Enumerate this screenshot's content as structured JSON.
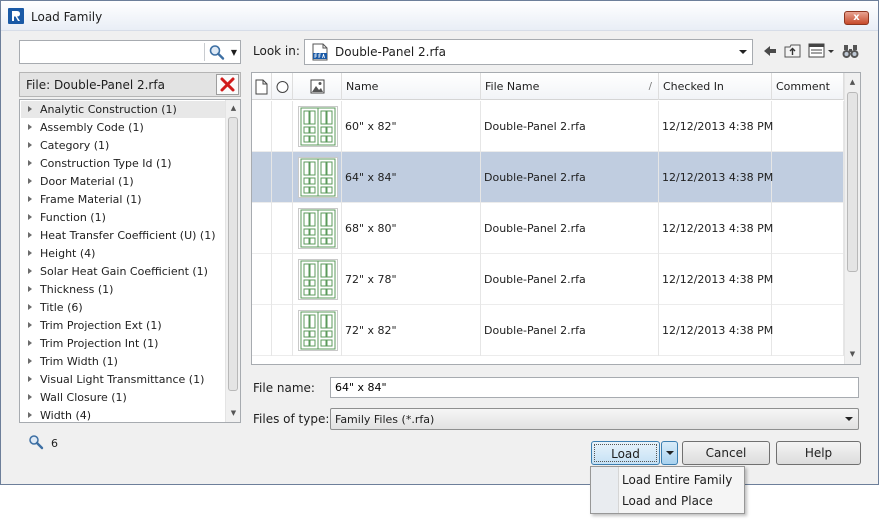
{
  "window": {
    "title": "Load Family",
    "close_label": "x"
  },
  "search": {
    "placeholder": "",
    "value": "",
    "match_count": "6"
  },
  "filter_file": {
    "label": "File: Double-Panel 2.rfa"
  },
  "parameters": [
    "Analytic Construction (1)",
    "Assembly Code (1)",
    "Category (1)",
    "Construction Type Id (1)",
    "Door Material (1)",
    "Frame Material (1)",
    "Function (1)",
    "Heat Transfer Coefficient (U) (1)",
    "Height (4)",
    "Solar Heat Gain Coefficient (1)",
    "Thickness (1)",
    "Title (6)",
    "Trim Projection Ext (1)",
    "Trim Projection Int (1)",
    "Trim Width (1)",
    "Visual Light Transmittance (1)",
    "Wall Closure (1)",
    "Width (4)"
  ],
  "look_in": {
    "label": "Look in:",
    "value": "Double-Panel 2.rfa"
  },
  "grid": {
    "columns": [
      "Name",
      "File Name",
      "Checked In",
      "Comment"
    ],
    "rows": [
      {
        "name": "60\" x 82\"",
        "file": "Double-Panel 2.rfa",
        "checked": "12/12/2013 4:38 PM",
        "comment": ""
      },
      {
        "name": "64\" x 84\"",
        "file": "Double-Panel 2.rfa",
        "checked": "12/12/2013 4:38 PM",
        "comment": "",
        "selected": true
      },
      {
        "name": "68\" x 80\"",
        "file": "Double-Panel 2.rfa",
        "checked": "12/12/2013 4:38 PM",
        "comment": ""
      },
      {
        "name": "72\" x 78\"",
        "file": "Double-Panel 2.rfa",
        "checked": "12/12/2013 4:38 PM",
        "comment": ""
      },
      {
        "name": "72\" x 82\"",
        "file": "Double-Panel 2.rfa",
        "checked": "12/12/2013 4:38 PM",
        "comment": ""
      }
    ]
  },
  "file_name": {
    "label": "File name:",
    "value": "64\" x 84\""
  },
  "file_type": {
    "label": "Files of type:",
    "value": "Family Files (*.rfa)"
  },
  "buttons": {
    "load": "Load",
    "cancel": "Cancel",
    "help": "Help"
  },
  "load_menu": [
    "Load Entire Family",
    "Load and Place"
  ],
  "colors": {
    "selection": "#c0cde0",
    "accent": "#3c7fb1",
    "close": "#c74a2b"
  }
}
